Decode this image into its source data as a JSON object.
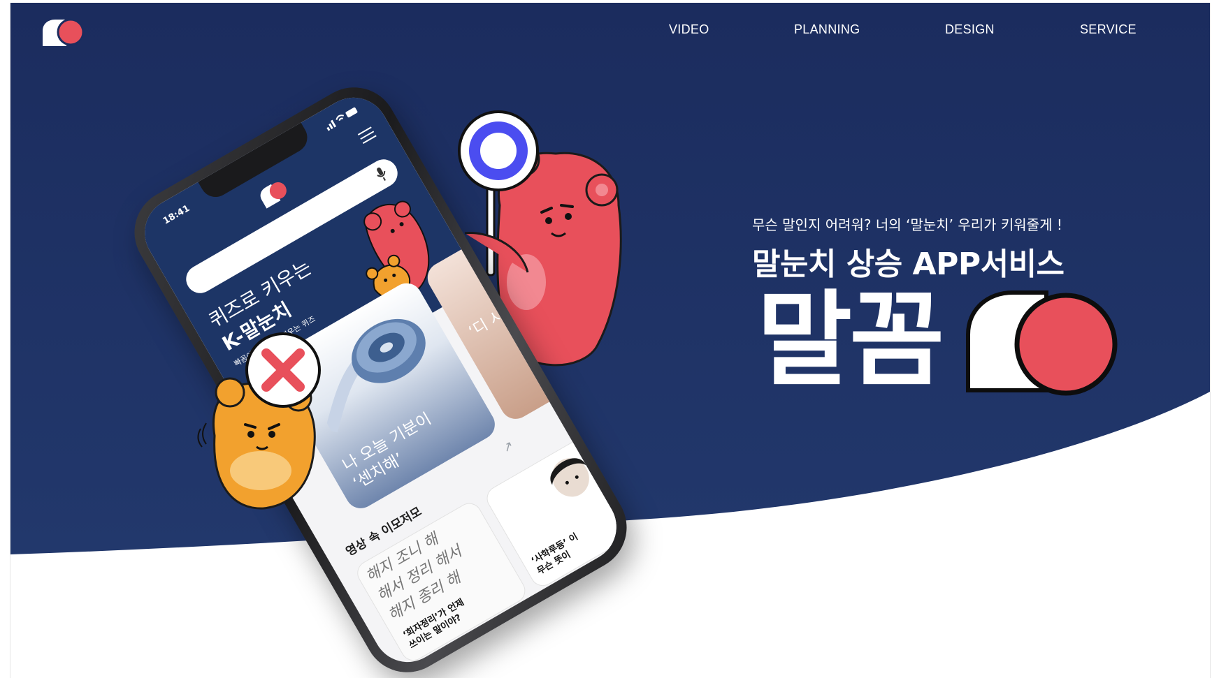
{
  "header": {
    "logo_label": "말꼼 logo",
    "nav": [
      "VIDEO",
      "PLANNING",
      "DESIGN",
      "SERVICE"
    ]
  },
  "hero": {
    "tagline": "무슨 말인지 어려워? 너의 ‘말눈치’ 우리가 키워줄게 !",
    "headline": "말눈치 상승 APP서비스",
    "brand_name": "말꼼"
  },
  "phone": {
    "status_time": "18:41",
    "title_line1": "퀴즈로 키우는",
    "title_line2": "K-말눈치",
    "subtitle": "빠꼼이와 쪼꼼씩 배우는 퀴즈",
    "card_main_text": "나 오늘 기분이\n‘센치해’",
    "card_side_text": "‘디\n시",
    "section_title": "영상 속 이모저모",
    "card_bottom_handwriting": "해지 조니  해\n해서 정리  해서\n해지 종리  해",
    "card_bottom_caption": "‘회자정리’가 언제\n쓰이는 말이야?",
    "card_bottom_side_caption": "‘사학루등’ 이\n무슨 뜻이"
  },
  "signs": {
    "o_sign": "O",
    "x_sign": "X"
  },
  "colors": {
    "navy": "#1c2f63",
    "coral": "#e8505b",
    "orange": "#f2a12e",
    "white": "#ffffff"
  }
}
